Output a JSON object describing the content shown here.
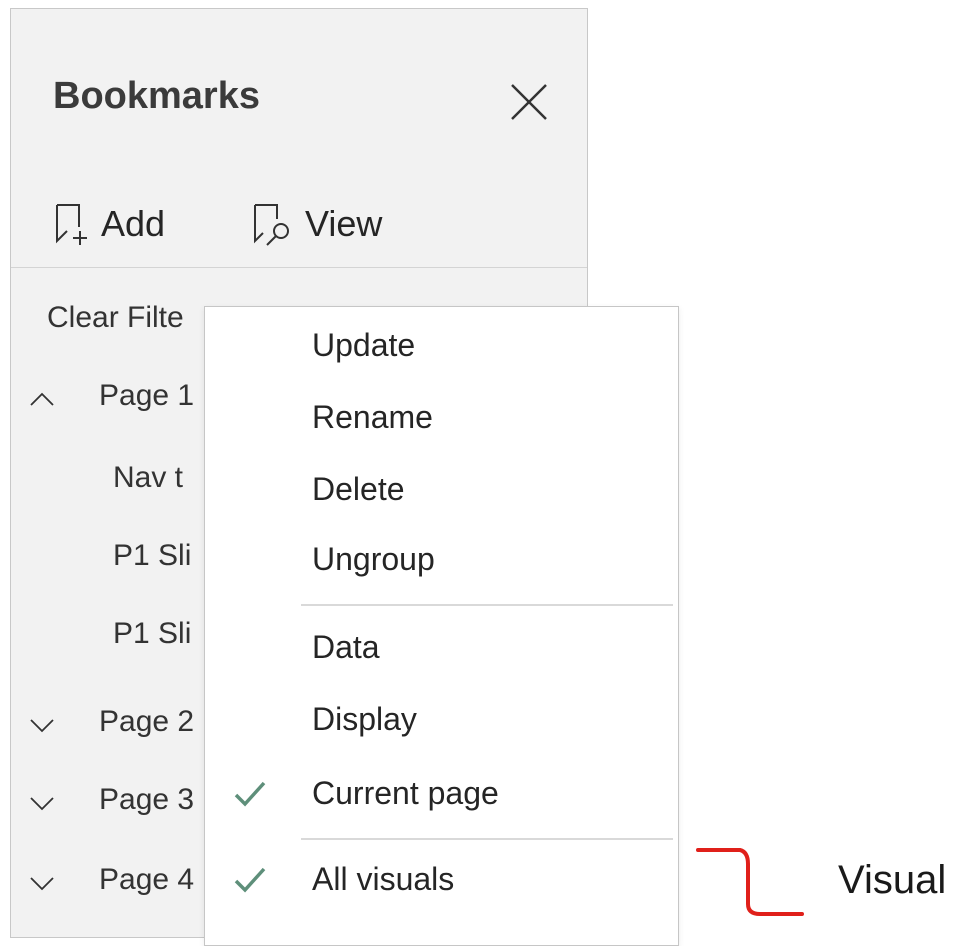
{
  "pane": {
    "title": "Bookmarks",
    "add_label": "Add",
    "view_label": "View",
    "items": [
      {
        "label": "Clear Filte"
      },
      {
        "label": "Page 1"
      },
      {
        "label": "Nav t"
      },
      {
        "label": "P1 Sli"
      },
      {
        "label": "P1 Sli"
      },
      {
        "label": "Page 2"
      },
      {
        "label": "Page 3"
      },
      {
        "label": "Page 4"
      }
    ]
  },
  "context_menu": {
    "items": [
      {
        "label": "Update",
        "checked": false
      },
      {
        "label": "Rename",
        "checked": false
      },
      {
        "label": "Delete",
        "checked": false
      },
      {
        "label": "Ungroup",
        "checked": false
      },
      {
        "label": "Data",
        "checked": false
      },
      {
        "label": "Display",
        "checked": false
      },
      {
        "label": "Current page",
        "checked": true
      },
      {
        "label": "All visuals",
        "checked": true
      }
    ]
  },
  "annotation": {
    "text": "Visual"
  },
  "colors": {
    "pane_bg": "#f2f2f2",
    "check": "#5e8f7a",
    "annotation_line": "#e0201a"
  }
}
